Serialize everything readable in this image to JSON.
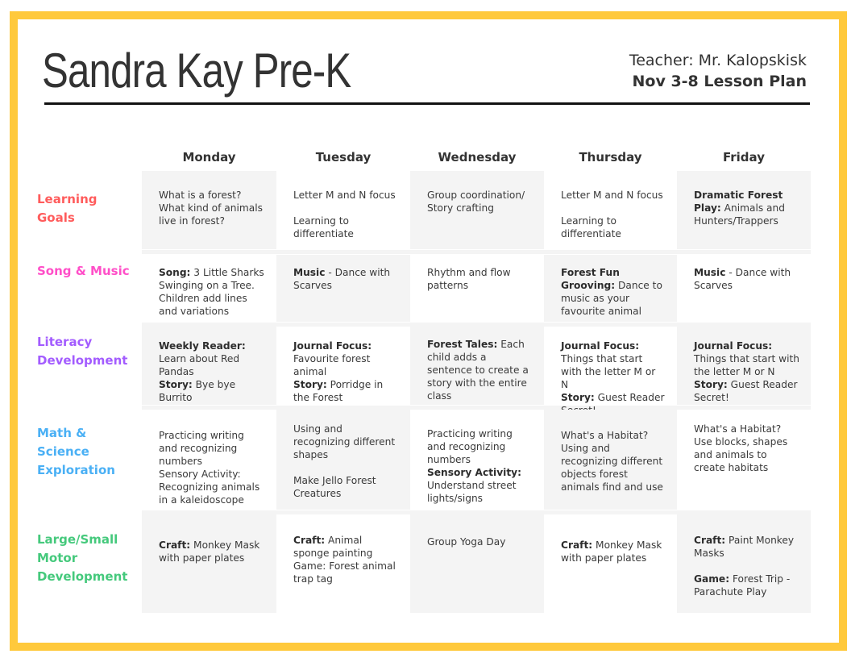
{
  "header": {
    "title": "Sandra Kay Pre-K",
    "teacher": "Teacher: Mr. Kalopskisk",
    "plan": "Nov 3-8 Lesson Plan"
  },
  "colors": {
    "frame": "#FFC93C",
    "learning_goals": "#FF5C5C",
    "song_music": "#FF4FC8",
    "literacy": "#A35CFF",
    "math_science": "#4AB0F5",
    "motor": "#45C97C",
    "cell_gray": "#F4F4F4"
  },
  "days": [
    "Monday",
    "Tuesday",
    "Wednesday",
    "Thursday",
    "Friday"
  ],
  "rows": [
    {
      "label": "Learning Goals",
      "cells": [
        [
          {
            "t": "What is a forest? What kind of animals live in forest?"
          }
        ],
        [
          {
            "t": "Letter M and N focus"
          },
          {
            "gap": true
          },
          {
            "t": "Learning to differentiate"
          }
        ],
        [
          {
            "t": "Group coordination/ Story crafting"
          }
        ],
        [
          {
            "t": "Letter M and N focus"
          },
          {
            "gap": true
          },
          {
            "t": "Learning to differentiate"
          }
        ],
        [
          {
            "b": "Dramatic Forest Play:",
            "t": " Animals and Hunters/Trappers"
          }
        ]
      ]
    },
    {
      "label": "Song & Music",
      "cells": [
        [
          {
            "b": "Song:",
            "t": " 3 Little Sharks Swinging on a Tree. Children add lines and variations"
          }
        ],
        [
          {
            "b": "Music",
            "t": " - Dance with Scarves"
          }
        ],
        [
          {
            "t": "Rhythm and flow patterns"
          }
        ],
        [
          {
            "b": "Forest Fun Grooving:",
            "t": " Dance to music as your favourite animal"
          }
        ],
        [
          {
            "b": "Music",
            "t": " - Dance with Scarves"
          }
        ]
      ]
    },
    {
      "label": "Literacy Development",
      "cells": [
        [
          {
            "b": "Weekly Reader:",
            "t": " Learn about Red Pandas"
          },
          {
            "b": "Story:",
            "t": " Bye bye Burrito"
          }
        ],
        [
          {
            "b": "Journal Focus:",
            "t": " Favourite forest animal"
          },
          {
            "b": "Story:",
            "t": " Porridge in the Forest"
          }
        ],
        [
          {
            "b": "Forest Tales:",
            "t": " Each child adds a sentence to create a story with the entire class"
          }
        ],
        [
          {
            "b": "Journal Focus:",
            "t": " Things that start with the letter M or N"
          },
          {
            "b": "Story:",
            "t": " Guest Reader Secret!"
          }
        ],
        [
          {
            "b": "Journal Focus:",
            "t": " Things that start with the letter M or N"
          },
          {
            "b": "Story:",
            "t": " Guest Reader Secret!"
          }
        ]
      ]
    },
    {
      "label": "Math & Science Exploration",
      "cells": [
        [
          {
            "t": "Practicing writing and recognizing numbers"
          },
          {
            "t": "Sensory Activity: Recognizing animals in a kaleidoscope"
          }
        ],
        [
          {
            "t": "Using and recognizing different shapes"
          },
          {
            "gap": true
          },
          {
            "t": "Make Jello Forest Creatures"
          }
        ],
        [
          {
            "t": "Practicing writing and recognizing numbers"
          },
          {
            "b": "Sensory Activity:",
            "t": " Understand street lights/signs"
          }
        ],
        [
          {
            "t": "What's a Habitat? Using and recognizing different objects forest animals find and use"
          }
        ],
        [
          {
            "t": "What's a Habitat? Use blocks, shapes and animals to create habitats"
          }
        ]
      ]
    },
    {
      "label": "Large/Small Motor Development",
      "cells": [
        [
          {
            "b": "Craft:",
            "t": " Monkey Mask with paper plates"
          }
        ],
        [
          {
            "b": "Craft:",
            "t": " Animal sponge painting"
          },
          {
            "t": "Game: Forest animal trap tag"
          }
        ],
        [
          {
            "t": "Group Yoga Day"
          }
        ],
        [
          {
            "b": "Craft:",
            "t": " Monkey Mask with paper plates"
          }
        ],
        [
          {
            "b": "Craft:",
            "t": " Paint Monkey Masks"
          },
          {
            "gap": true
          },
          {
            "b": "Game:",
            "t": " Forest Trip - Parachute Play"
          }
        ]
      ]
    }
  ]
}
